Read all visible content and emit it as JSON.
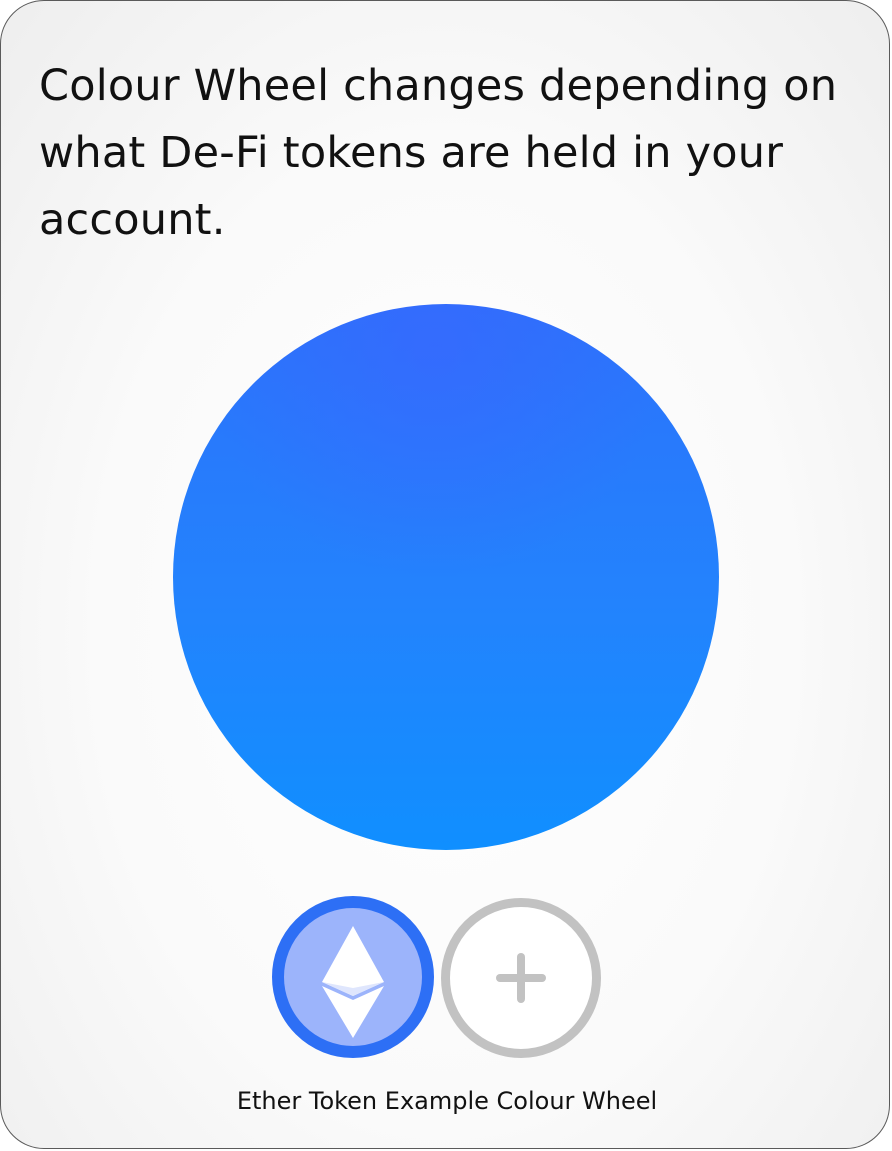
{
  "card": {
    "headline": "Colour Wheel changes depending on what De-Fi tokens are held in your account.",
    "caption": "Ether Token Example Colour Wheel"
  },
  "wheel": {
    "color_top": "#2c72fb",
    "color_bottom": "#108fff"
  },
  "tokens": [
    {
      "icon": "ethereum-icon",
      "ring_color": "#2d6ff5",
      "fill_color": "#9cb4fb"
    },
    {
      "icon": "plus-icon",
      "ring_color": "#c2c2c2",
      "fill_color": "#ffffff"
    }
  ]
}
